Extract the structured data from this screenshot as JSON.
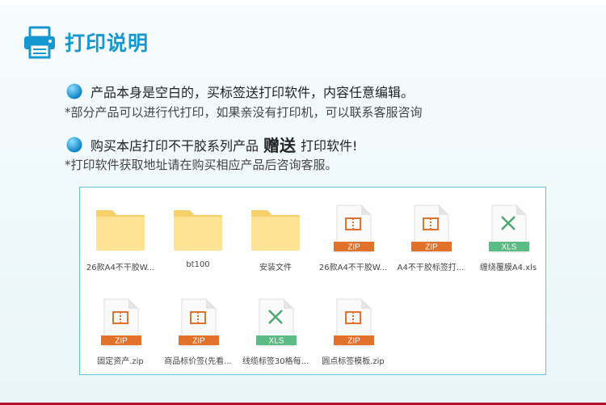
{
  "header": {
    "title": "打印说明",
    "icon": "printer-icon"
  },
  "lines": {
    "line1": "产品本身是空白的，买标签送打印软件，内容任意编辑。",
    "line2": "*部分产品可以进行代打印，如果亲没有打印机，可以联系客服咨询",
    "line3_before": "购买本店打印不干胶系列产品",
    "line3_emph": "赠送",
    "line3_after": "打印软件!",
    "line4": "*打印软件获取地址请在购买相应产品后咨询客服。"
  },
  "colors": {
    "accent": "#1597d0",
    "zip": "#e2712b",
    "xls": "#5bbb84",
    "folder": "#fde393",
    "panel_border": "#5ec3e6",
    "bottom_bar": "#b3142b"
  },
  "files": [
    {
      "type": "folder",
      "label": "26款A4不干胶W..."
    },
    {
      "type": "folder",
      "label": "bt100"
    },
    {
      "type": "folder",
      "label": "安装文件"
    },
    {
      "type": "zip",
      "badge": "ZIP",
      "label": "26款A4不干胶W..."
    },
    {
      "type": "zip",
      "badge": "ZIP",
      "label": "A4不干胶标签打..."
    },
    {
      "type": "xls",
      "badge": "XLS",
      "label": "缠绕覆膜A4.xls"
    },
    {
      "type": "zip",
      "badge": "ZIP",
      "label": "固定资产.zip"
    },
    {
      "type": "zip",
      "badge": "ZIP",
      "label": "商品标价签(先看..."
    },
    {
      "type": "xls",
      "badge": "XLS",
      "label": "线缆标签30格每..."
    },
    {
      "type": "zip",
      "badge": "ZIP",
      "label": "圆点标签模板.zip"
    }
  ]
}
